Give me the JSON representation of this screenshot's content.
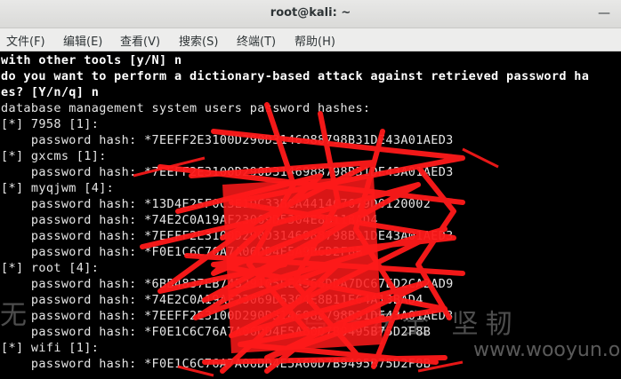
{
  "window": {
    "title": "root@kali: ~",
    "minimize_glyph": "—"
  },
  "menu": [
    {
      "label": "文件(F)"
    },
    {
      "label": "编辑(E)"
    },
    {
      "label": "查看(V)"
    },
    {
      "label": "搜索(S)"
    },
    {
      "label": "终端(T)"
    },
    {
      "label": "帮助(H)"
    }
  ],
  "terminal": {
    "lines": [
      {
        "text": "with other tools [y/N] n",
        "bold": true
      },
      {
        "text": "do you want to perform a dictionary-based attack against retrieved password ha",
        "bold": true
      },
      {
        "text": "es? [Y/n/q] n",
        "bold": true
      },
      {
        "text": "database management system users password hashes:",
        "bold": false
      },
      {
        "text": "[*] 7958 [1]:",
        "bold": false
      },
      {
        "text": "    password hash: *7EEFF2E3100D290D3146988798B31DE43A01AED3",
        "bold": false
      },
      {
        "text": "[*] gxcms [1]:",
        "bold": false
      },
      {
        "text": "    password hash: *7EEFF2E3100D290D3146988798B31DE43A01AED3",
        "bold": false
      },
      {
        "text": "[*] myqjwm [4]:",
        "bold": false
      },
      {
        "text": "    password hash: *13D4E25F0C3E1DC33BCA4414C7679D0120002",
        "bold": false
      },
      {
        "text": "    password hash: *74E2C0A19AF23069D5304E8B11BAD4",
        "bold": false
      },
      {
        "text": "    password hash: *7EEFF2E3100D290D3146988798B31DE43A01AED3",
        "bold": false
      },
      {
        "text": "    password hash: *F0E1C6C76A7A06DD4E5A9B6D2F8B",
        "bold": false
      },
      {
        "text": "[*] root [4]:",
        "bold": false
      },
      {
        "text": "    password hash: *6BB4837EB74329105EE4568DDA7DC67ED2CA2AD9",
        "bold": false
      },
      {
        "text": "    password hash: *74E2C0A19AF23069D5304E8B11E64A13BAD4",
        "bold": false
      },
      {
        "text": "    password hash: *7EEFF2E3100D290D3146988798B31DE43A01AED3",
        "bold": false
      },
      {
        "text": "    password hash: *F0E1C6C76A7A06DD4E5A60D7B9495B75D2F8B",
        "bold": false
      },
      {
        "text": "[*] wifi [1]:",
        "bold": false
      },
      {
        "text": "    password hash: *F0E1C6C76A7A06DD4E5A60D7B9495B75D2F8B",
        "bold": false
      }
    ]
  },
  "watermark": {
    "chinese": "乌云安全 坚韧",
    "left": "无",
    "url": "www.wooyun.org"
  },
  "colors": {
    "terminal_bg": "#000000",
    "terminal_fg": "#e6e6e6",
    "redaction": "#ff1a1a"
  }
}
